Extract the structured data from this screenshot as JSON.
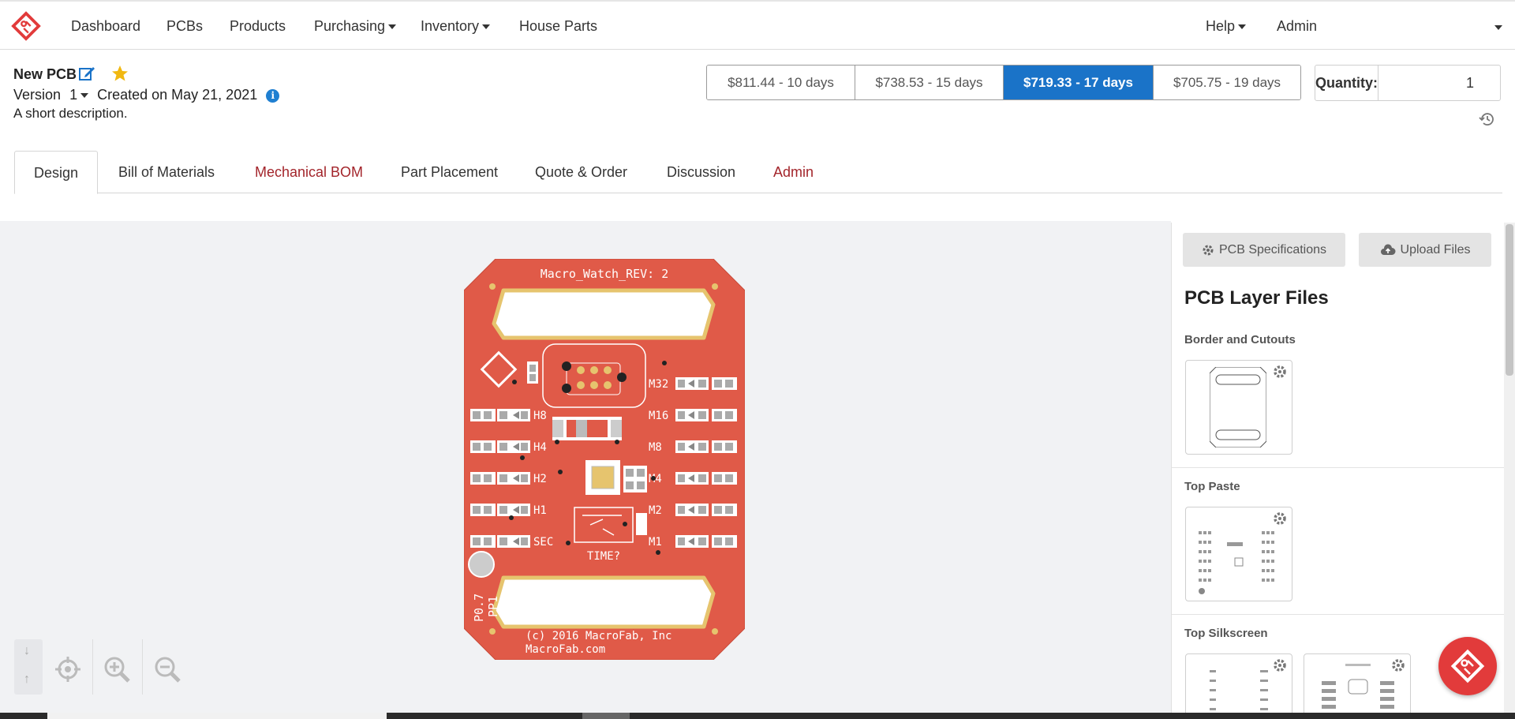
{
  "nav": {
    "items": [
      {
        "label": "Dashboard"
      },
      {
        "label": "PCBs"
      },
      {
        "label": "Products"
      },
      {
        "label": "Purchasing"
      },
      {
        "label": "Inventory"
      },
      {
        "label": "House Parts"
      }
    ],
    "right": {
      "help": "Help",
      "admin": "Admin"
    }
  },
  "header": {
    "name": "New PCB",
    "version_label": "Version",
    "version_value": "1",
    "created": "Created on May 21, 2021",
    "description": "A short description."
  },
  "pricing": {
    "options": [
      {
        "label": "$811.44 - 10 days",
        "active": false
      },
      {
        "label": "$738.53 - 15 days",
        "active": false
      },
      {
        "label": "$719.33 - 17 days",
        "active": true
      },
      {
        "label": "$705.75 - 19 days",
        "active": false
      }
    ],
    "quantity_label": "Quantity:",
    "quantity_value": "1"
  },
  "tabs": [
    {
      "label": "Design",
      "active": true
    },
    {
      "label": "Bill of Materials"
    },
    {
      "label": "Mechanical BOM"
    },
    {
      "label": "Part Placement"
    },
    {
      "label": "Quote & Order"
    },
    {
      "label": "Discussion"
    },
    {
      "label": "Admin"
    }
  ],
  "pcb": {
    "title": "Macro_Watch_REV: 2",
    "left_labels": [
      "H8",
      "H4",
      "H2",
      "H1",
      "SEC"
    ],
    "right_labels": [
      "M32",
      "M16",
      "M8",
      "M4",
      "M2",
      "M1"
    ],
    "center_label": "TIME?",
    "side_label_1": "P0.7",
    "side_label_2": "PP1",
    "copyright": "(c) 2016 MacroFab, Inc",
    "url": "MacroFab.com",
    "board_color": "#e05a48",
    "gold_color": "#e6c46e"
  },
  "panel": {
    "spec_button": "PCB Specifications",
    "upload_button": "Upload Files",
    "title": "PCB Layer Files",
    "sections": [
      {
        "label": "Border and Cutouts"
      },
      {
        "label": "Top Paste"
      },
      {
        "label": "Top Silkscreen"
      }
    ]
  },
  "colors": {
    "accent": "#1a73c8",
    "brand_red": "#e23b3b",
    "tab_red": "#a3252b"
  }
}
